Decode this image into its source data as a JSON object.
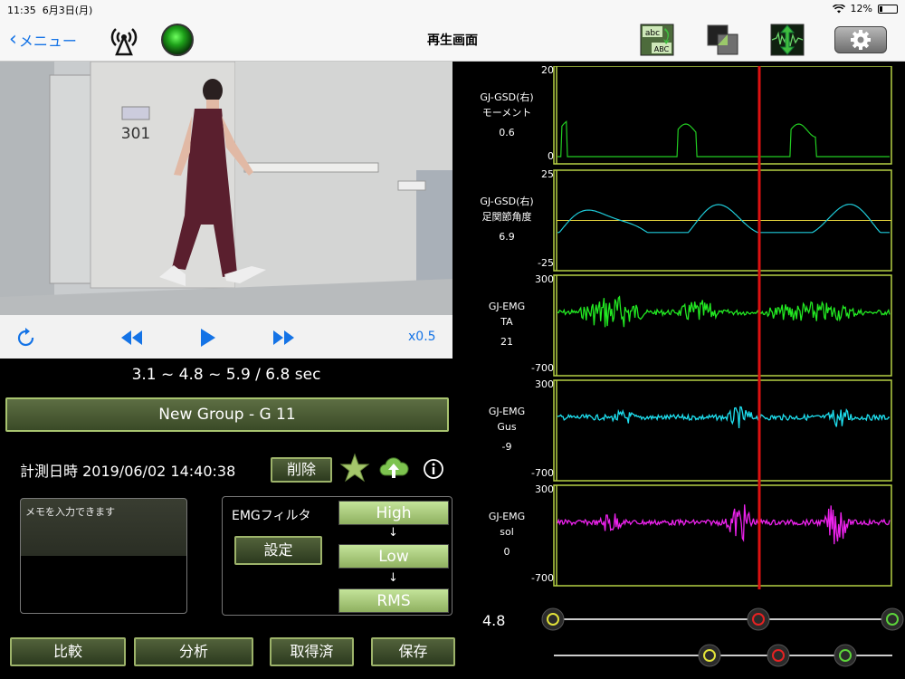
{
  "status": {
    "time": "11:35",
    "date": "6月3日(月)",
    "battery": "12%"
  },
  "nav": {
    "back_label": "メニュー",
    "title": "再生画面"
  },
  "toolbar": {
    "abc_icon_top": "abc",
    "abc_icon_bottom": "ABC"
  },
  "player": {
    "speed": "x0.5",
    "timeline": "3.1 ~ 4.8 ~ 5.9 / 6.8 sec",
    "room_number": "301"
  },
  "group": {
    "label": "New Group - G 11"
  },
  "measurement": {
    "label": "計測日時 2019/06/02 14:40:38",
    "delete_label": "削除"
  },
  "memo": {
    "placeholder": "メモを入力できます"
  },
  "emg_filter": {
    "label": "EMGフィルタ",
    "settings_label": "設定",
    "high": "High",
    "low": "Low",
    "rms": "RMS",
    "arrow": "↓"
  },
  "buttons": {
    "compare": "比較",
    "analyze": "分析",
    "acquired": "取得済",
    "save": "保存"
  },
  "channels": [
    {
      "name1": "GJ-GSD(右)",
      "name2": "モーメント",
      "value": "0.6",
      "max": "20",
      "min": "0",
      "color": "#22cc22"
    },
    {
      "name1": "GJ-GSD(右)",
      "name2": "足関節角度",
      "value": "6.9",
      "max": "25",
      "min": "-25",
      "color": "#1ecbd9"
    },
    {
      "name1": "GJ-EMG",
      "name2": "TA",
      "value": "21",
      "max": "300",
      "min": "-700",
      "color": "#22e822"
    },
    {
      "name1": "GJ-EMG",
      "name2": "Gus",
      "value": "-9",
      "max": "300",
      "min": "-700",
      "color": "#1ee0f0"
    },
    {
      "name1": "GJ-EMG",
      "name2": "sol",
      "value": "0",
      "max": "300",
      "min": "-700",
      "color": "#ee22ee"
    }
  ],
  "cursor_value": "4.8",
  "colors": {
    "accent": "#1473e6",
    "button_border": "#9db36a",
    "cursor": "#dd1111",
    "frame": "#b5d044"
  }
}
